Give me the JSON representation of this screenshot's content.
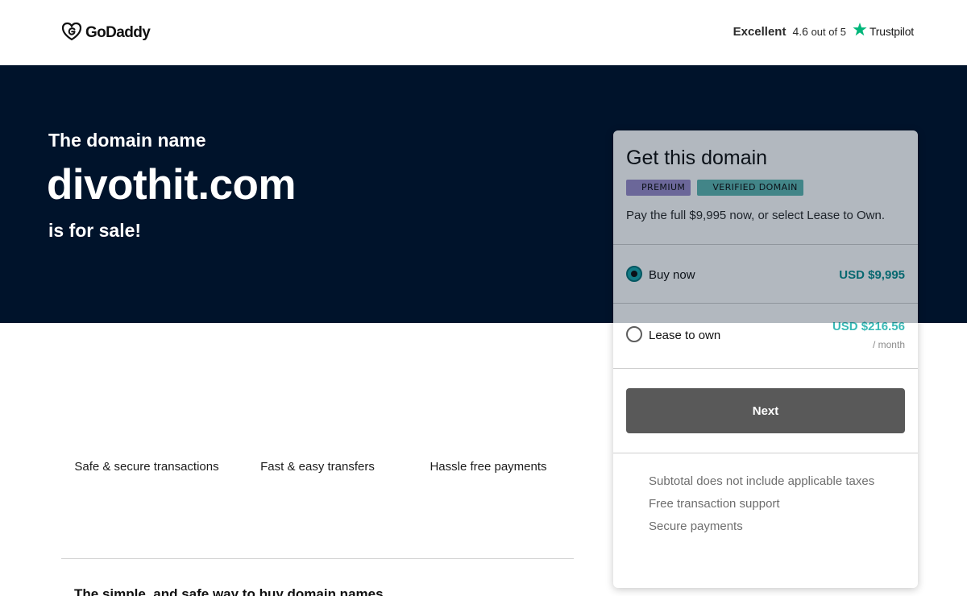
{
  "header": {
    "logo_text": "GoDaddy",
    "trustpilot": {
      "rating_word": "Excellent",
      "score": "4.6",
      "score_suffix": "out of 5",
      "brand": "Trustpilot",
      "star_color": "#00b67a"
    }
  },
  "hero": {
    "pre": "The domain name",
    "domain": "divothit.com",
    "post": "is for sale!",
    "background": "#00132b"
  },
  "features": [
    "Safe & secure transactions",
    "Fast & easy transfers",
    "Hassle free payments"
  ],
  "bottom_heading": "The simple, and safe way to buy domain names",
  "card": {
    "title": "Get this domain",
    "badges": {
      "premium": "PREMIUM",
      "verified": "VERIFIED DOMAIN"
    },
    "description": "Pay the full $9,995 now, or select Lease to Own.",
    "options": [
      {
        "label": "Buy now",
        "price": "USD $9,995",
        "selected": true
      },
      {
        "label": "Lease to own",
        "price": "USD $216.56",
        "unit": "/ month",
        "selected": false
      }
    ],
    "next_label": "Next",
    "notes": [
      "Subtotal does not include applicable taxes",
      "Free transaction support",
      "Secure payments"
    ],
    "accent_color": "#0b8d8f"
  }
}
